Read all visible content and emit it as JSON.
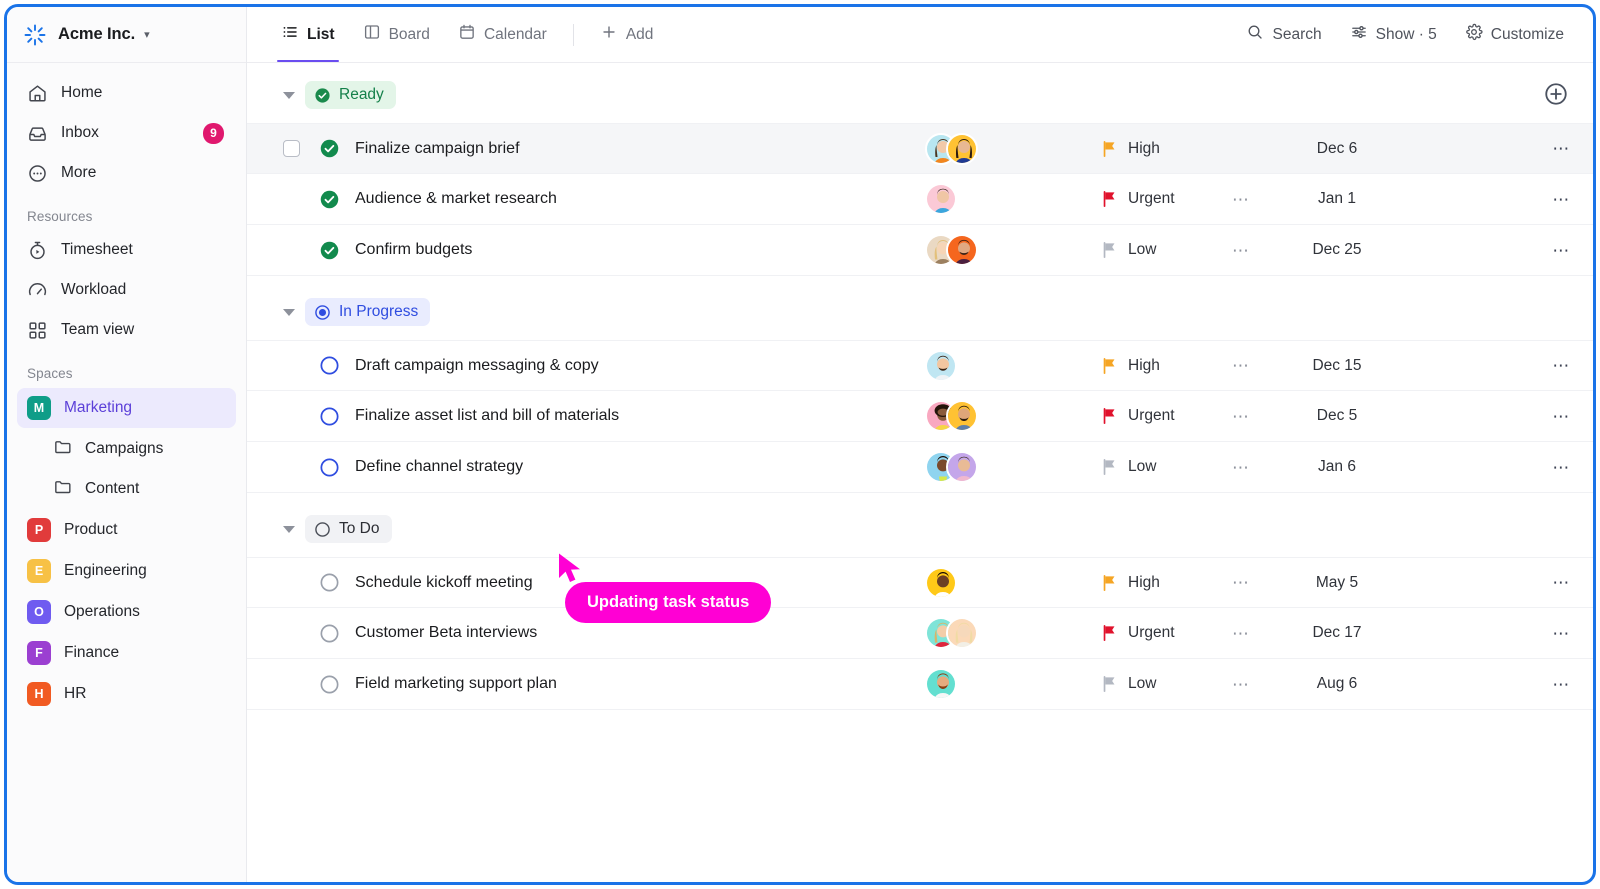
{
  "brand": {
    "name": "Acme Inc.",
    "logo_icon": "starburst-logo",
    "caret_icon": "chevron-down-icon"
  },
  "sidebar": {
    "nav": [
      {
        "label": "Home",
        "icon": "home-icon",
        "badge": ""
      },
      {
        "label": "Inbox",
        "icon": "inbox-icon",
        "badge": "9"
      },
      {
        "label": "More",
        "icon": "more-dots-icon",
        "badge": ""
      }
    ],
    "resources_label": "Resources",
    "resources": [
      {
        "label": "Timesheet",
        "icon": "stopwatch-icon"
      },
      {
        "label": "Workload",
        "icon": "gauge-icon"
      },
      {
        "label": "Team view",
        "icon": "grid-icon"
      }
    ],
    "spaces_label": "Spaces",
    "spaces": [
      {
        "label": "Marketing",
        "initial": "M",
        "color": "#0f9d88",
        "active": true
      },
      {
        "label": "Product",
        "initial": "P",
        "color": "#e13b3b",
        "active": false
      },
      {
        "label": "Engineering",
        "initial": "E",
        "color": "#f7c145",
        "active": false
      },
      {
        "label": "Operations",
        "initial": "O",
        "color": "#6f5bf0",
        "active": false
      },
      {
        "label": "Finance",
        "initial": "F",
        "color": "#9b3fd1",
        "active": false
      },
      {
        "label": "HR",
        "initial": "H",
        "color": "#f15a22",
        "active": false
      }
    ],
    "folders": [
      {
        "label": "Campaigns",
        "icon": "folder-icon"
      },
      {
        "label": "Content",
        "icon": "folder-icon"
      }
    ]
  },
  "toolbar": {
    "tabs": [
      {
        "label": "List",
        "icon": "list-icon",
        "active": true
      },
      {
        "label": "Board",
        "icon": "board-icon",
        "active": false
      },
      {
        "label": "Calendar",
        "icon": "calendar-icon",
        "active": false
      }
    ],
    "add_label": "Add",
    "add_icon": "plus-icon",
    "search_label": "Search",
    "search_icon": "search-icon",
    "show_label": "Show · 5",
    "show_icon": "sliders-icon",
    "customize_label": "Customize",
    "customize_icon": "gear-icon"
  },
  "list": {
    "add_task_icon": "circle-plus-icon",
    "groups": [
      {
        "status": "Ready",
        "status_style": "ready",
        "status_icon": "check-circle-filled-icon",
        "collapse_icon": "triangle-down-icon",
        "tasks": [
          {
            "name": "Finalize campaign brief",
            "status_icon": "check-circle-green-icon",
            "priority": "High",
            "priority_color": "#f5a524",
            "due": "Dec 6",
            "hovered": true,
            "checkbox": true,
            "assignees": [
              {
                "skin": "#f2c9a8",
                "hair": "#4b3621",
                "shirt": "#f2861e",
                "bg": "#b8e6f0"
              },
              {
                "skin": "#e8b893",
                "hair": "#2c1b10",
                "shirt": "#1f3a93",
                "bg": "#ffc233"
              }
            ]
          },
          {
            "name": "Audience & market research",
            "status_icon": "check-circle-green-icon",
            "priority": "Urgent",
            "priority_color": "#e0122c",
            "due": "Jan 1",
            "hovered": false,
            "checkbox": false,
            "assignees": [
              {
                "skin": "#f0c6a5",
                "hair": "#2e1f14",
                "shirt": "#3aa6dd",
                "bg": "#fbc9d6"
              }
            ]
          },
          {
            "name": "Confirm budgets",
            "status_icon": "check-circle-green-icon",
            "priority": "Low",
            "priority_color": "#b3b8c2",
            "due": "Dec 25",
            "hovered": false,
            "checkbox": false,
            "assignees": [
              {
                "skin": "#f6d5b6",
                "hair": "#e3c07a",
                "shirt": "#9c8060",
                "bg": "#ead9c3"
              },
              {
                "skin": "#e0a882",
                "hair": "#3b2317",
                "shirt": "#4a2040",
                "bg": "#f5661e"
              }
            ]
          }
        ]
      },
      {
        "status": "In Progress",
        "status_style": "prog",
        "status_icon": "radio-filled-icon",
        "collapse_icon": "triangle-down-icon",
        "tasks": [
          {
            "name": "Draft campaign messaging & copy",
            "status_icon": "circle-blue-icon",
            "priority": "High",
            "priority_color": "#f5a524",
            "due": "Dec 15",
            "hovered": false,
            "checkbox": false,
            "assignees": [
              {
                "skin": "#f2c6a0",
                "hair": "#3a2415",
                "shirt": "#eef3f6",
                "bg": "#bfe6f2"
              }
            ]
          },
          {
            "name": "Finalize asset list and bill of materials",
            "status_icon": "circle-blue-icon",
            "priority": "Urgent",
            "priority_color": "#e0122c",
            "due": "Dec 5",
            "hovered": false,
            "checkbox": false,
            "assignees": [
              {
                "skin": "#8a5a3c",
                "hair": "#241309",
                "shirt": "#f5d547",
                "bg": "#f9a8c0"
              },
              {
                "skin": "#dfa579",
                "hair": "#2f1d10",
                "shirt": "#5e7fa8",
                "bg": "#ffc233"
              }
            ]
          },
          {
            "name": "Define channel strategy",
            "status_icon": "circle-blue-icon",
            "priority": "Low",
            "priority_color": "#b3b8c2",
            "due": "Jan 6",
            "hovered": false,
            "checkbox": false,
            "assignees": [
              {
                "skin": "#7a4a2c",
                "hair": "#1b0e06",
                "shirt": "#d8e84a",
                "bg": "#8fd4ef"
              },
              {
                "skin": "#e9bb96",
                "hair": "#3c2a18",
                "shirt": "#f0b8cf",
                "bg": "#c4a6ea"
              }
            ]
          }
        ]
      },
      {
        "status": "To Do",
        "status_style": "todo",
        "status_icon": "circle-gray-icon",
        "collapse_icon": "triangle-down-icon",
        "tasks": [
          {
            "name": "Schedule kickoff meeting",
            "status_icon": "circle-gray-icon",
            "priority": "High",
            "priority_color": "#f5a524",
            "due": "May 5",
            "hovered": false,
            "checkbox": false,
            "assignees": [
              {
                "skin": "#6b4024",
                "hair": "#120703",
                "shirt": "#ffffff",
                "bg": "#ffc918"
              }
            ]
          },
          {
            "name": "Customer Beta interviews",
            "status_icon": "circle-gray-icon",
            "priority": "Urgent",
            "priority_color": "#e0122c",
            "due": "Dec 17",
            "hovered": false,
            "checkbox": false,
            "assignees": [
              {
                "skin": "#f3cda8",
                "hair": "#d9b46a",
                "shirt": "#e0243c",
                "bg": "#7fe4d8"
              },
              {
                "skin": "#f6d9bb",
                "hair": "#f0dba4",
                "shirt": "#f2efe6",
                "bg": "#fbd9b8"
              }
            ]
          },
          {
            "name": "Field marketing support plan",
            "status_icon": "circle-gray-icon",
            "priority": "Low",
            "priority_color": "#b3b8c2",
            "due": "Aug 6",
            "hovered": false,
            "checkbox": false,
            "assignees": [
              {
                "skin": "#e5ab7e",
                "hair": "#8a3f14",
                "shirt": "#f7f7f7",
                "bg": "#63dfd0"
              }
            ]
          }
        ]
      }
    ]
  },
  "cursor": {
    "tooltip": "Updating task status",
    "tooltip_color": "#ff00d4",
    "pointer_icon": "mouse-pointer-icon"
  }
}
